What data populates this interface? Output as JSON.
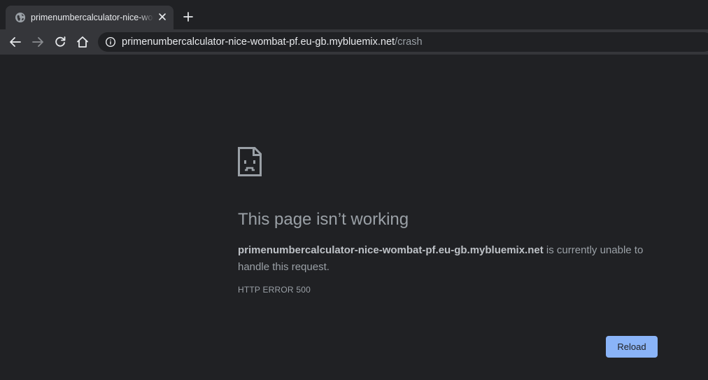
{
  "browser": {
    "tab": {
      "title": "primenumbercalculator-nice-wombat-pf.eu-gb.mybluemix.net/crash",
      "favicon": "globe-icon",
      "close": "close-icon"
    },
    "new_tab": "plus-icon",
    "toolbar": {
      "back": "arrow-left-icon",
      "forward": "arrow-right-icon",
      "reload": "refresh-icon",
      "home": "home-icon"
    },
    "omnibox": {
      "info": "info-icon",
      "host": "primenumbercalculator-nice-wombat-pf.eu-gb.mybluemix.net",
      "path": "/crash"
    }
  },
  "error_page": {
    "icon": "sad-page-icon",
    "title": "This page isn’t working",
    "host": "primenumbercalculator-nice-wombat-pf.eu-gb.mybluemix.net",
    "message": " is currently unable to handle this request.",
    "code": "HTTP ERROR 500",
    "reload_label": "Reload"
  },
  "colors": {
    "background": "#202124",
    "toolbar": "#35363a",
    "text": "#9aa0a6",
    "accent": "#8ab4f8"
  }
}
